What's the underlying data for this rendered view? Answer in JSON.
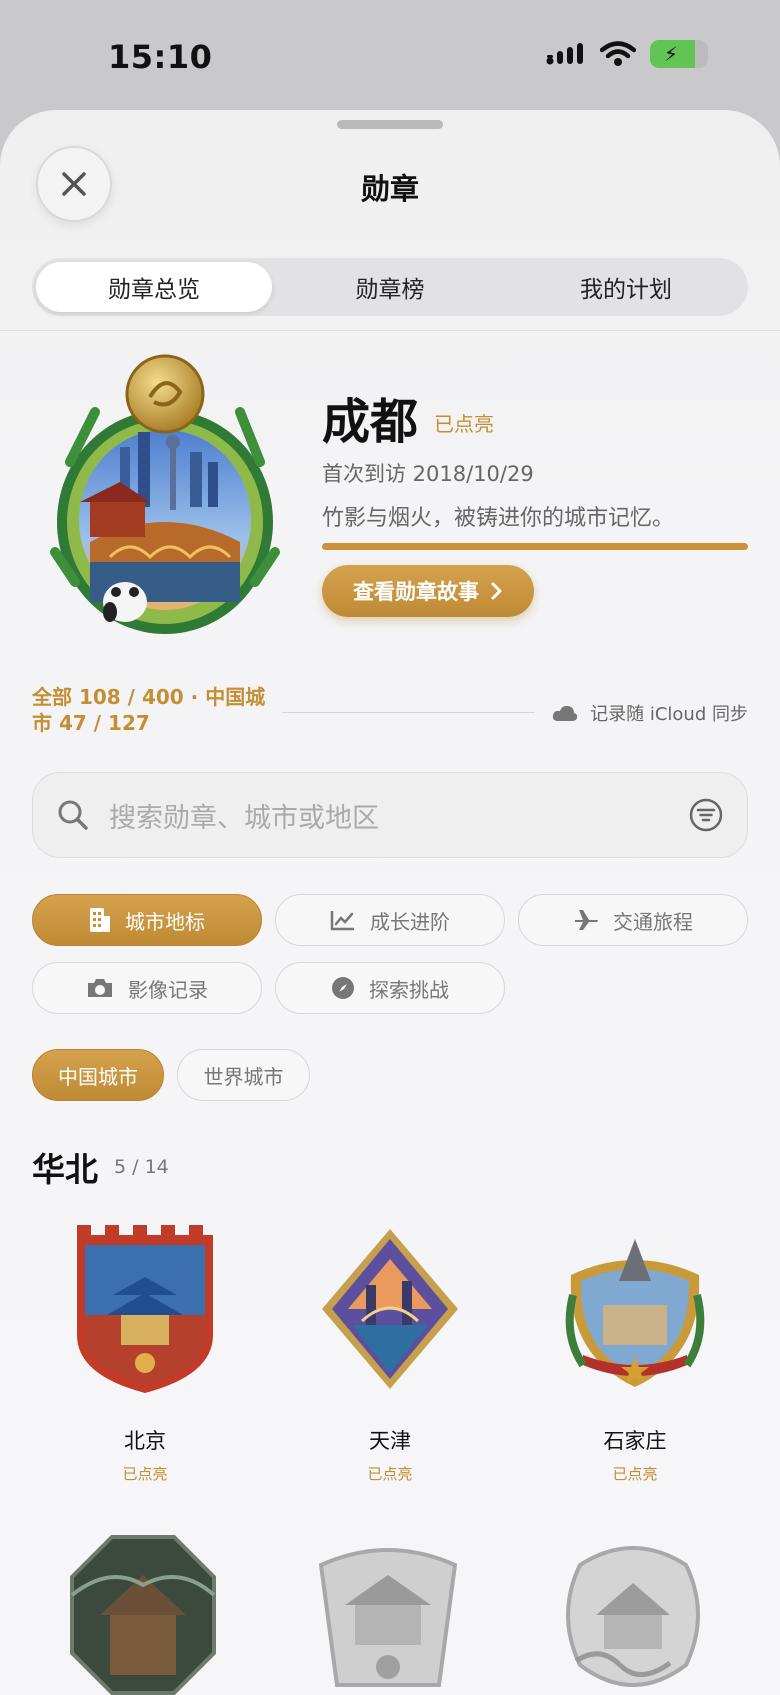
{
  "status_bar": {
    "time": "15:10"
  },
  "sheet": {
    "title": "勋章"
  },
  "tabs": [
    {
      "label": "勋章总览",
      "active": true
    },
    {
      "label": "勋章榜",
      "active": false
    },
    {
      "label": "我的计划",
      "active": false
    }
  ],
  "hero": {
    "city": "成都",
    "status": "已点亮",
    "first_visit": "首次到访 2018/10/29",
    "description": "竹影与烟火，被铸进你的城市记忆。",
    "story_button": "查看勋章故事"
  },
  "summary": {
    "counts_line1": "全部 108 / 400 · 中国城",
    "counts_line2": "市 47 / 127",
    "sync": "记录随 iCloud 同步"
  },
  "search": {
    "placeholder": "搜索勋章、城市或地区"
  },
  "categories": [
    {
      "label": "城市地标",
      "icon": "building-icon",
      "active": true
    },
    {
      "label": "成长进阶",
      "icon": "chart-icon",
      "active": false
    },
    {
      "label": "交通旅程",
      "icon": "airplane-icon",
      "active": false
    },
    {
      "label": "影像记录",
      "icon": "camera-icon",
      "active": false
    },
    {
      "label": "探索挑战",
      "icon": "compass-icon",
      "active": false
    }
  ],
  "scope": [
    {
      "label": "中国城市",
      "active": true
    },
    {
      "label": "世界城市",
      "active": false
    }
  ],
  "region": {
    "name": "华北",
    "count": "5 / 14",
    "badges": [
      {
        "name": "北京",
        "status": "已点亮"
      },
      {
        "name": "天津",
        "status": "已点亮"
      },
      {
        "name": "石家庄",
        "status": "已点亮"
      }
    ]
  },
  "colors": {
    "accent": "#c48f34",
    "button_gold": "#c9923b",
    "battery_green": "#62c454"
  }
}
